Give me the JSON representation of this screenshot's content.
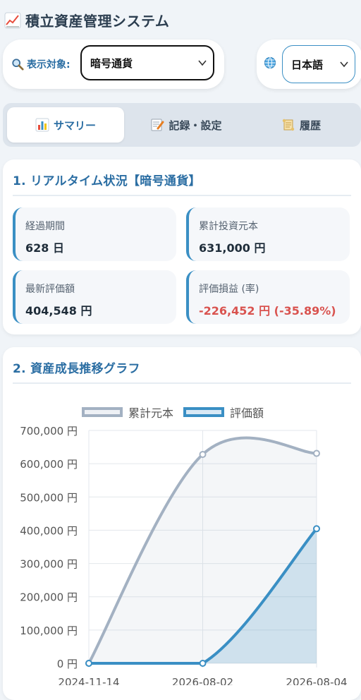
{
  "header": {
    "title": "積立資産管理システム",
    "icon": "chart-increasing-icon"
  },
  "selector": {
    "label": "表示対象:",
    "value": "暗号通貨"
  },
  "language": {
    "value": "日本語"
  },
  "tabs": [
    {
      "label": "サマリー",
      "icon": "bar-chart-icon",
      "active": true
    },
    {
      "label": "記録・設定",
      "icon": "memo-icon",
      "active": false
    },
    {
      "label": "履歴",
      "icon": "scroll-icon",
      "active": false
    }
  ],
  "status": {
    "title": "1. リアルタイム状況【暗号通貨】",
    "items": [
      {
        "label": "経過期間",
        "value": "628 日"
      },
      {
        "label": "累計投資元本",
        "value": "631,000 円"
      },
      {
        "label": "最新評価額",
        "value": "404,548 円"
      },
      {
        "label": "評価損益 (率)",
        "value": "-226,452 円 (-35.89%)"
      }
    ]
  },
  "growth": {
    "title": "2. 資産成長推移グラフ"
  },
  "colors": {
    "accent": "#2b6ea3",
    "principal": "#a3b1c2",
    "valuation": "#3a8fc4",
    "loss": "#d9534f"
  },
  "chart_data": {
    "type": "area",
    "x": [
      "2024-11-14",
      "2026-08-02",
      "2026-08-04"
    ],
    "series": [
      {
        "name": "累計元本",
        "values": [
          0,
          628000,
          631000
        ]
      },
      {
        "name": "評価額",
        "values": [
          0,
          0,
          404548
        ]
      }
    ],
    "yticks": [
      "700,000 円",
      "600,000 円",
      "500,000 円",
      "400,000 円",
      "300,000 円",
      "200,000 円",
      "100,000 円",
      "0 円"
    ],
    "ylim": [
      0,
      700000
    ],
    "legend": "top",
    "grid": true
  }
}
